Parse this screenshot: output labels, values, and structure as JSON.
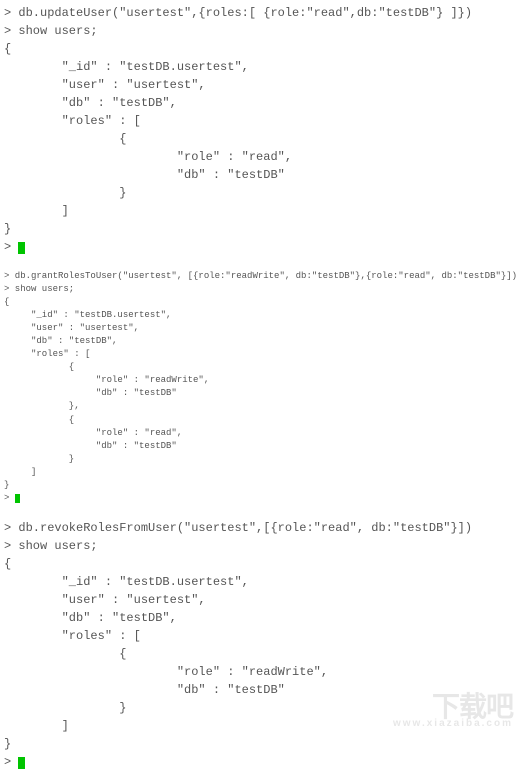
{
  "block1": {
    "cmd1": "> db.updateUser(\"usertest\",{roles:[ {role:\"read\",db:\"testDB\"} ]})",
    "cmd2": "> show users;",
    "out": "{\n        \"_id\" : \"testDB.usertest\",\n        \"user\" : \"usertest\",\n        \"db\" : \"testDB\",\n        \"roles\" : [\n                {\n                        \"role\" : \"read\",\n                        \"db\" : \"testDB\"\n                }\n        ]\n}",
    "prompt": "> "
  },
  "block2": {
    "cmd1": "> db.grantRolesToUser(\"usertest\", [{role:\"readWrite\", db:\"testDB\"},{role:\"read\", db:\"testDB\"}])",
    "cmd2": "> show users;",
    "out": "{\n     \"_id\" : \"testDB.usertest\",\n     \"user\" : \"usertest\",\n     \"db\" : \"testDB\",\n     \"roles\" : [\n            {\n                 \"role\" : \"readWrite\",\n                 \"db\" : \"testDB\"\n            },\n            {\n                 \"role\" : \"read\",\n                 \"db\" : \"testDB\"\n            }\n     ]\n}",
    "prompt": "> "
  },
  "block3": {
    "cmd1": "> db.revokeRolesFromUser(\"usertest\",[{role:\"read\", db:\"testDB\"}])",
    "cmd2": "> show users;",
    "out": "{\n        \"_id\" : \"testDB.usertest\",\n        \"user\" : \"usertest\",\n        \"db\" : \"testDB\",\n        \"roles\" : [\n                {\n                        \"role\" : \"readWrite\",\n                        \"db\" : \"testDB\"\n                }\n        ]\n}",
    "prompt": "> "
  },
  "watermark": {
    "main": "下载吧",
    "sub": "www.xiazaiba.com"
  }
}
